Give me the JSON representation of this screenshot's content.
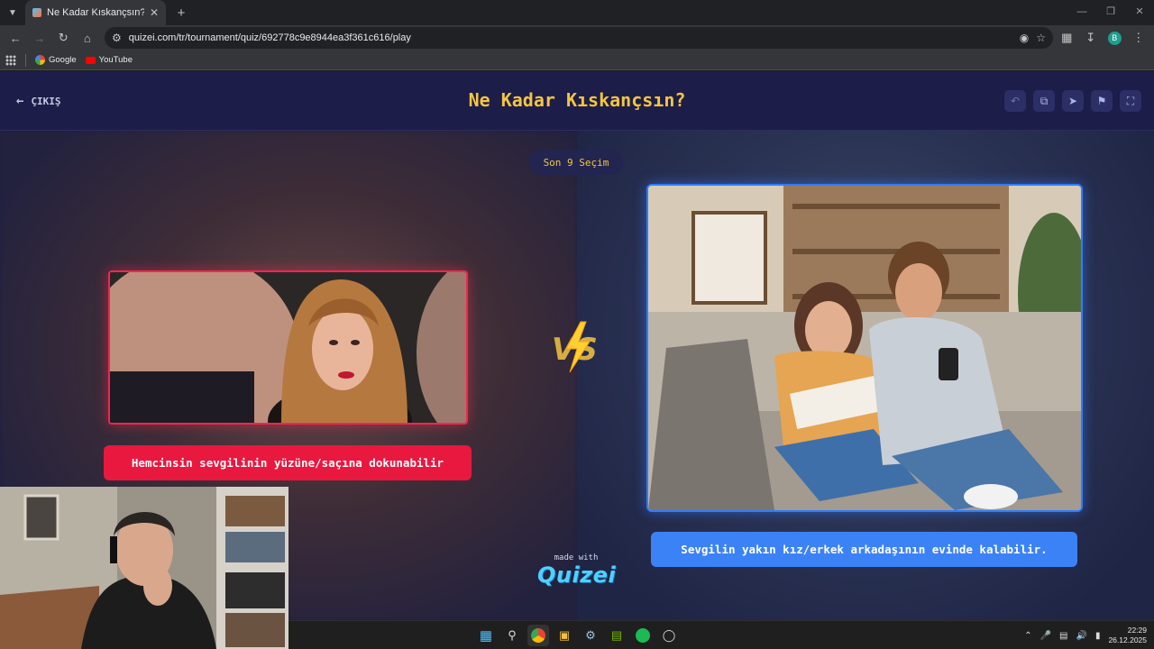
{
  "browser": {
    "tab_title": "Ne Kadar Kıskançsın? - Tier List",
    "url": "quizei.com/tr/tournament/quiz/692778c9e8944ea3f361c616/play",
    "profile_initial": "B",
    "bookmarks": [
      {
        "label": "Google",
        "icon": "google-icon"
      },
      {
        "label": "YouTube",
        "icon": "youtube-icon"
      }
    ]
  },
  "page": {
    "exit_label": "ÇIKIŞ",
    "title": "Ne Kadar Kıskançsın?",
    "round_badge": "Son 9 Seçim",
    "left_option": "Hemcinsin sevgilinin yüzüne/saçına dokunabilir",
    "right_option": "Sevgilin yakın kız/erkek arkadaşının evinde kalabilir.",
    "vs_label": "VS",
    "made_with": "made with",
    "brand": "Quizei",
    "colors": {
      "left_accent": "#e8183f",
      "right_accent": "#3b82f6",
      "title": "#f5c542"
    }
  },
  "taskbar": {
    "time": "22:29",
    "date": "26.12.2025"
  }
}
